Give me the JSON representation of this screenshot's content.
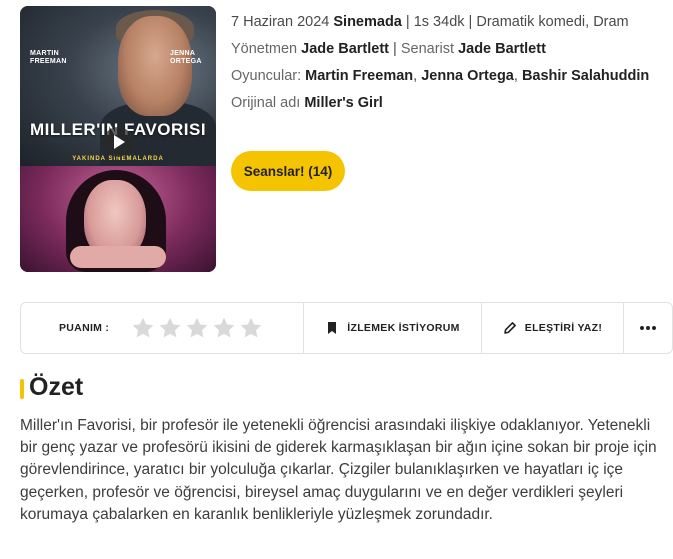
{
  "poster": {
    "title": "MILLER'IN FAVORISI",
    "subtitle": "YAKINDA SİNEMALARDA",
    "actor1": "MARTIN FREEMAN",
    "actor2": "JENNA ORTEGA"
  },
  "movie": {
    "date": "7 Haziran 2024",
    "status": "Sinemada",
    "duration": "1s 34dk",
    "genre": "Dramatik komedi, Dram",
    "director_label": "Yönetmen",
    "director": "Jade Bartlett",
    "writer_label": "Senarist",
    "writer": "Jade Bartlett",
    "cast_label": "Oyuncular:",
    "cast": [
      "Martin Freeman",
      "Jenna Ortega",
      "Bashir Salahuddin"
    ],
    "original_label": "Orijinal adı",
    "original_title": "Miller's Girl"
  },
  "seans_button": "Seanslar! (14)",
  "action_bar": {
    "rating_label": "PUANIM :",
    "rating_value": 0,
    "rating_max": 5,
    "watchlist_label": "İZLEMEK İSTİYORUM",
    "review_label": "ELEŞTİRİ YAZ!"
  },
  "summary": {
    "heading": "Özet",
    "text": "Miller'ın Favorisi, bir profesör ile yetenekli öğrencisi arasındaki ilişkiye odaklanıyor. Yetenekli bir genç yazar ve profesörü ikisini de giderek karmaşıklaşan bir ağın içine sokan bir proje için görevlendirince, yaratıcı bir yolculuğa çıkarlar. Çizgiler bulanıklaşırken ve hayatları iç içe geçerken, profesör ve öğrencisi, bireysel amaç duygularını ve en değer verdikleri şeyleri korumaya çabalarken en karanlık benlikleriyle yüzleşmek zorundadır."
  },
  "colors": {
    "accent": "#f5c400",
    "star_empty": "#d9d9d9"
  },
  "icons": [
    "play-icon",
    "star-icon",
    "bookmark-icon",
    "pencil-icon",
    "more-icon"
  ]
}
